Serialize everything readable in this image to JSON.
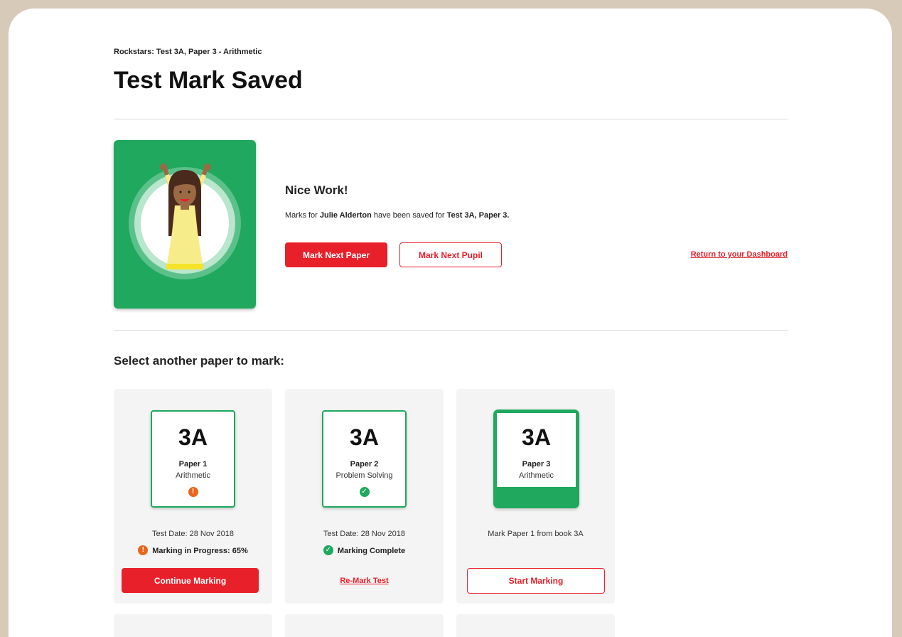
{
  "breadcrumb": "Rockstars: Test 3A, Paper 3 - Arithmetic",
  "title": "Test Mark Saved",
  "hero": {
    "heading": "Nice Work!",
    "message_prefix": "Marks for ",
    "pupil_name": "Julie Alderton",
    "message_middle": " have been saved for ",
    "test_name": "Test 3A, Paper 3.",
    "mark_next_paper": "Mark Next Paper",
    "mark_next_pupil": "Mark Next Pupil",
    "dashboard_link": "Return to your Dashboard"
  },
  "section_title": "Select another paper to mark:",
  "papers": [
    {
      "code": "3A",
      "paper": "Paper 1",
      "subject": "Arithmetic",
      "status_icon": "warning-icon",
      "badge_glyph": "!",
      "date": "Test Date: 28 Nov 2018",
      "status": "Marking in Progress: 65%",
      "progress_percent": 65,
      "action": "Continue Marking"
    },
    {
      "code": "3A",
      "paper": "Paper 2",
      "subject": "Problem Solving",
      "status_icon": "check-icon",
      "badge_glyph": "✓",
      "date": "Test Date: 28 Nov 2018",
      "status": "Marking Complete",
      "action": "Re-Mark Test"
    },
    {
      "code": "3A",
      "paper": "Paper 3",
      "subject": "Arithmetic",
      "note": "Mark Paper 1 from book 3A",
      "action": "Start Marking"
    }
  ],
  "colors": {
    "accent_red": "#e8202a",
    "brand_green": "#1fa85e",
    "warning_orange": "#e8661c",
    "frame_bg": "#d8cab9",
    "card_bg": "#f4f4f4"
  }
}
